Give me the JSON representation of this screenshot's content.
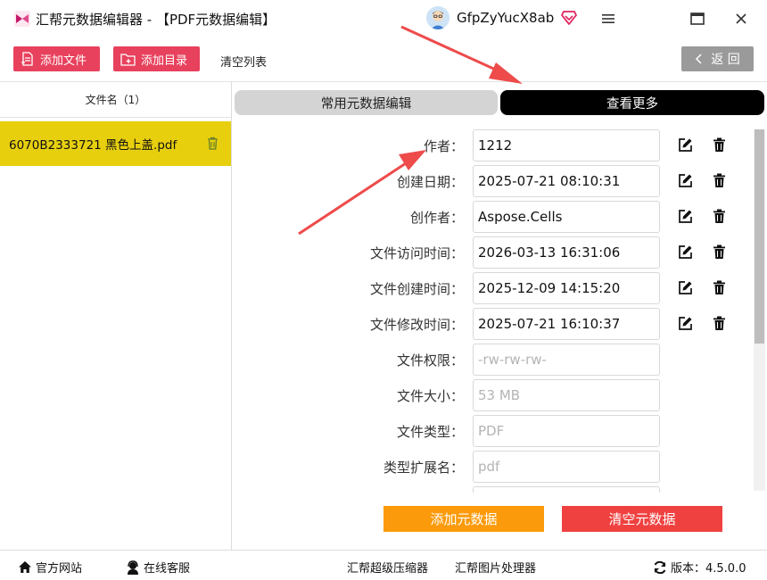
{
  "window": {
    "title": "汇帮元数据编辑器 - 【PDF元数据编辑】",
    "username": "GfpZyYucX8ab",
    "icons": [
      "app-logo-icon",
      "user-avatar-icon",
      "vip-diamond-icon",
      "menu-icon",
      "maximize-icon",
      "close-icon"
    ]
  },
  "toolbar": {
    "add_file": "添加文件",
    "add_folder": "添加目录",
    "clear_list": "清空列表",
    "back": "返 回",
    "accent_color": "#e8415d"
  },
  "file_list": {
    "header": "文件名（1）",
    "files": [
      {
        "name": "6070B2333721 黑色上盖.pdf"
      }
    ],
    "selected_color": "#e8cf0e"
  },
  "tabs": [
    {
      "label": "常用元数据编辑",
      "active": false
    },
    {
      "label": "查看更多",
      "active": true
    }
  ],
  "fields": [
    {
      "label": "作者：",
      "value": "1212",
      "editable": true
    },
    {
      "label": "创建日期：",
      "value": "2025-07-21 08:10:31",
      "editable": true
    },
    {
      "label": "创作者：",
      "value": "Aspose.Cells",
      "editable": true
    },
    {
      "label": "文件访问时间：",
      "value": "2026-03-13 16:31:06",
      "editable": true
    },
    {
      "label": "文件创建时间：",
      "value": "2025-12-09 14:15:20",
      "editable": true
    },
    {
      "label": "文件修改时间：",
      "value": "2025-07-21 16:10:37",
      "editable": true
    },
    {
      "label": "文件权限：",
      "value": "-rw-rw-rw-",
      "editable": false
    },
    {
      "label": "文件大小：",
      "value": "53 MB",
      "editable": false
    },
    {
      "label": "文件类型：",
      "value": "PDF",
      "editable": false
    },
    {
      "label": "类型扩展名：",
      "value": "pdf",
      "editable": false
    }
  ],
  "actions": {
    "add_meta": "添加元数据",
    "clear_meta": "清空元数据",
    "add_color": "#fb9a0a",
    "clear_color": "#ef4140"
  },
  "status": {
    "website": "官方网站",
    "support": "在线客服",
    "compressor": "汇帮超级压缩器",
    "image_tool": "汇帮图片处理器",
    "version": "版本：4.5.0.0"
  }
}
